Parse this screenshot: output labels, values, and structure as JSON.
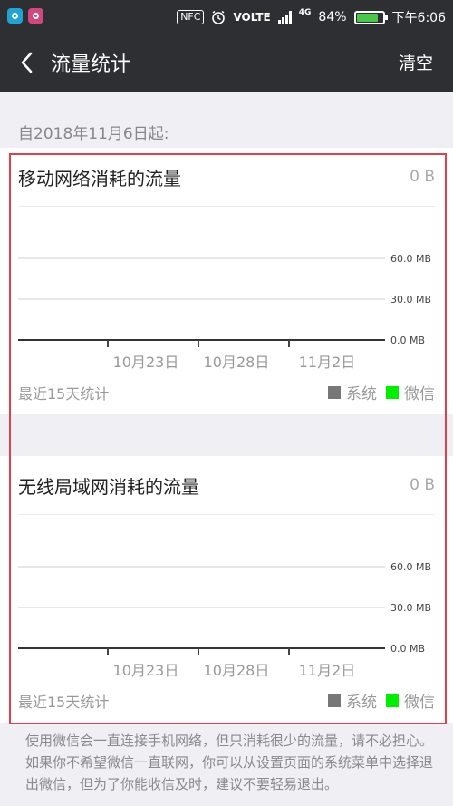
{
  "status_bar": {
    "nfc": "NFC",
    "volte": "VOLTE",
    "network": "4G",
    "battery_pct": "84%",
    "battery_level": 0.84,
    "time": "下午6:06",
    "icons": [
      "app-notification-icon",
      "app-notification-icon",
      "alarm-icon",
      "signal-icon",
      "battery-icon"
    ]
  },
  "toolbar": {
    "title": "流量统计",
    "clear_label": "清空",
    "back_icon": "chevron-left-icon"
  },
  "since_label": "自2018年11月6日起:",
  "cards": [
    {
      "title": "移动网络消耗的流量",
      "total": "0 B",
      "recent_label": "最近15天统计"
    },
    {
      "title": "无线局域网消耗的流量",
      "total": "0 B",
      "recent_label": "最近15天统计"
    }
  ],
  "legend": {
    "system_label": "系统",
    "wechat_label": "微信",
    "system_color": "#777777",
    "wechat_color": "#00ee00"
  },
  "chart_data": [
    {
      "type": "bar",
      "x_ticks": [
        "10月23日",
        "10月28日",
        "11月2日"
      ],
      "y_ticks": [
        "0.0 MB",
        "30.0 MB",
        "60.0 MB"
      ],
      "ylim": [
        0,
        60
      ],
      "series": [
        {
          "name": "系统",
          "values": [
            0,
            0,
            0
          ]
        },
        {
          "name": "微信",
          "values": [
            0,
            0,
            0
          ]
        }
      ]
    },
    {
      "type": "bar",
      "x_ticks": [
        "10月23日",
        "10月28日",
        "11月2日"
      ],
      "y_ticks": [
        "0.0 MB",
        "30.0 MB",
        "60.0 MB"
      ],
      "ylim": [
        0,
        60
      ],
      "series": [
        {
          "name": "系统",
          "values": [
            0,
            0,
            0
          ]
        },
        {
          "name": "微信",
          "values": [
            0,
            0,
            0
          ]
        }
      ]
    }
  ],
  "footer": "使用微信会一直连接手机网络，但只消耗很少的流量，请不必担心。如果你不希望微信一直联网，你可以从设置页面的系统菜单中选择退出微信，但为了你能收信及时，建议不要轻易退出。"
}
